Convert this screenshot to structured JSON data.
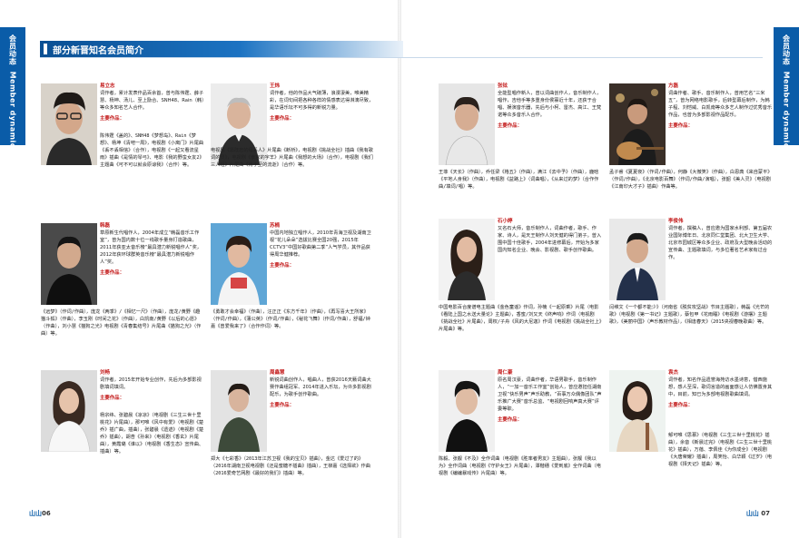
{
  "section": {
    "tab_cn": "会员动态",
    "tab_en": "Member dynamics",
    "title": "部分新晋知名会员简介"
  },
  "members": [
    {
      "name": "易立志",
      "bio": "词作者，累计发表作品百余首，曾与陈伟霆、薛子慧、杨坤、汤儿、至上励合、SNH48、Rain（韩）等众多知名艺人合作。",
      "works_label": "主要作品：",
      "works": "陈伟霆《盖的》、SNH48《梦想岛》、Rain《梦想》、杨坤《清吧一周》，电视剧《小离门》片尾曲《丢不丢相信》（合作），电视剧《一起又看流星雨》插曲《是情的琴弓》、电影《我的野蛮女友2》主题曲《可不可以就会原谅我》（合作）等。"
    },
    {
      "name": "王炜",
      "bio": "词作者，他的作品大气磅薄，浪漫凄美，唯美精彩，在词句间把各种各样的情感表达得淋漓尽致，是华语乐坛不可多得的新锐力量。",
      "works_label": "主要作品：",
      "works": "电视剧《靠既忠的母系人》片尾曲《断桥》，电视剧《挑战全社》插曲《我有歌词的灵》，电视剧《食家的字羊》片尾曲《我想的大场》（合作），电视剧《我们三人组》片尾曲《肯于至的流逝》（合作）等。"
    },
    {
      "name": "张铉",
      "bio": "全能型唱作新人，曾以词曲创作人，音乐制作人，唱作，吉他手等多重身份侯寡近十年，还获于合唱、娱演音乐器，先后与小柯、雷杰、高江、王梵诺等众多音乐人合作。",
      "works_label": "主要作品：",
      "works": "王菲《天长》（作曲），乔任梁《格五》（作曲），满江《去中予》（作曲），鹿晗《平地人身我》（作曲），电视剧《益路上》（词曲唱），《从来过的梦》（合作作曲/填词/唱）等。"
    },
    {
      "name": "方磊",
      "bio": "词曲作者、歌手、音乐制作人，曾用艺名“三米五”，曾为网络电影歌手，后转型幕后制作，为韩子程、刘恺威、白凯南等众多艺人制作过优秀音乐作品，也曾为多部影视作品配乐。",
      "works_label": "主要作品：",
      "works": "孟子睿《夏夏夜》（作词/作曲），何静《大微笑》（作曲），白恩典《来自蒙平》（作词/作曲），《北京电影百舞》（作词/作曲/演唱），张韶《美人灵》（电视剧《江南印大才子》插曲）作曲等。"
    },
    {
      "name": "韩磊",
      "bio": "草原新生代唱作人，2004年成立“韩磊音乐工作室”，曾为国内数十位一线歌手量身打造歌曲，2011年获亚太音乐榜“最具潜力新锐唱作人”奖，2012年获环球群英音乐榜“最具潜力新锐唱作人”奖。",
      "works_label": "主要作品：",
      "works": "《远梦》（作词/作曲），庞龙《两季》/《相忆一尺》（作曲），庞龙/黄野《趣猫斗狐》（作曲），李玉刚《时间之花》（作曲），白凯南/黄野《以后的心愿》（作曲），刘小慧《猫狗之光》电视剧《青春集结号》片尾曲《猫狗之光》（作曲）等。"
    },
    {
      "name": "苏楠",
      "bio": "中国内地独立唱作人，2010年青海卫视及湖南卫视“花儿朵朵”选拔比赛全国20强，2015年CCTV3“中国好歌曲第二季”人气学员，其作品获得周华健推荐。",
      "works_label": "主要作品：",
      "works": "《勇敢才会幸福》（作曲），汪正正《东方千年》（作曲），《再写喜大王所家》（作词/作曲），《蒲公英》（作词/作曲），《秘花飞舞》（作词/作曲），舒福/钟嘉《曾爱我来了》（合作作词）等。"
    },
    {
      "name": "石小婷",
      "bio": "又名石大师，音乐制作人，词曲作者，歌手、作家、诗人，是天王制作人刘天健的得门弟子。曾入围中国十佳歌手，2004年进修幕后，开始为多家国内知名企业、晚会、影视剧、歌手创作歌曲。",
      "works_label": "",
      "works": "中国电影百合度谱电主题曲《金色童谣》作词，孙楠《一起原乘》片尾（电影《看陆上国之水送大量论》主题曲），香蜜/刘又天《终声响》作词（电视剧《挑战全社》片尾曲），周权/子舟《风的大尼迦》作词《电视剧《挑战全社上》片尾曲》等。"
    },
    {
      "name": "李俊伟",
      "bio": "词作者，撰稿人，曾应邀为国家水利部、第五届农业国际博年日、北京同仁堂集团、北大卫生大学、北京市园城区等众多企业、政府及大型晚会活动的宣传曲、主题歌填词，与多位著名艺术家有过合作。",
      "works_label": "",
      "works": "闫维文《一个都不能少》（河南省《脱贫攻坚战》节目主题歌），韩磊《光芒的歌》（电视剧《第一书记》主题歌），蔡包甲《花雨睡》《电视剧《游摆》主题歌》，《美丽中国》（声乐教材作品），《相逢春天》（2015央视春晚歌曲）等。"
    },
    {
      "name": "刘畅",
      "bio": "词作者，2015年开始专业创作，先后为多部影视剧填词填词。",
      "works_label": "主要作品：",
      "works": "杨宗纬、张碧晨《凉凉》（电视剧《三生三世十里桃花》片尾曲），那可唯《风中有爱》（电视剧《楚乔》插广曲，插曲），张碧晨《遗迹》（电视剧《楚乔》插曲），胡杏《孙来》（电视剧《香玄》片尾曲），黄霞璐《谁以》（电视剧《香生态》宣传曲、插曲）等。"
    },
    {
      "name": "周鑫慧",
      "bio": "新锐词曲创作人，唱曲人，曾获2016天籁词曲大赛作曲组冠军、2014年进入乐坛，为许多影视剧配乐，为歌手创作歌曲。",
      "works_label": "主要作品：",
      "works": "郑大《七彩香》（2013年江苏卫视《我的宝贝》插曲），金达《爱过了的》（2016年湖南卫视电视剧《还是蜜糖不插曲》插曲），王柳嘉《选择欲》作曲（2016爱奇艺网剧《最好的我们》插曲）等。"
    },
    {
      "name": "周仁豪",
      "bio": "原名周汉豪，词曲作者，华语男歌手，音乐制作人，“一加一音乐工作室”创始人，曾应邀担任湖南卫视“快乐男声”声乐助教，“百事万众偶像团队”声乐推广大赛“音乐总监、“电视剧回响声真大赛”评委等职。",
      "works_label": "主要作品：",
      "works": "陈毅、张靓《不及》全作词曲（电视剧《胜率者男友》主题曲），张靓《我以为》全作词曲（电视剧《守护女王》片尾曲），潭楷穗《爱到底》全作词曲（电视剧《编编暴戏传》片尾曲）等。"
    },
    {
      "name": "袁杰",
      "bio": "词作者，知名作品遗誉海苑访水墨诗意，借西施想，感人至深，歌词言造的画面感让人仿佛置身其中，目前，知已为多部电视剧歌曲填词。",
      "works_label": "主要作品：",
      "works": "郁可唯《思慕》（电视剧《三生三世十里桃花》插曲），余音《新晨过完》（电视剧《三生三世十里桃花》插曲），万蓓、李佩佳《为你成全》（电视剧《大唐荣耀》插曲），周笑怡、白华颖《过岁》（电视剧《择天记》插曲）等。"
    }
  ],
  "folio": {
    "left_mark": "山山",
    "left_page": "06",
    "right_mark": "山山",
    "right_page": "07"
  },
  "colors": {
    "brand_blue": "#0a5ca8",
    "name_red": "#c41e1e"
  }
}
